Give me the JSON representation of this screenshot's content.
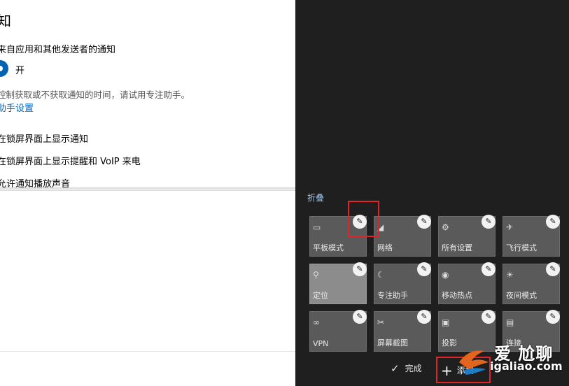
{
  "settings": {
    "heading": "知",
    "notify_from_apps": "来自应用和其他发送者的通知",
    "toggle_state": "开",
    "focus_hint": "控制获取或不获取通知的时间，请试用专注助手。",
    "focus_link": "助手设置",
    "lock_screen_notify": "在锁屏界面上显示通知",
    "lock_screen_voip": "在锁屏界面上显示提醒和 VoIP 来电",
    "allow_sound": "允许通知播放声音"
  },
  "action_center": {
    "collapse_label": "折叠",
    "tiles": [
      {
        "label": "平板模式",
        "icon": "tablet-mode-icon"
      },
      {
        "label": "网络",
        "icon": "network-icon"
      },
      {
        "label": "所有设置",
        "icon": "gear-icon"
      },
      {
        "label": "飞行模式",
        "icon": "airplane-icon"
      },
      {
        "label": "定位",
        "icon": "location-icon"
      },
      {
        "label": "专注助手",
        "icon": "moon-icon"
      },
      {
        "label": "移动热点",
        "icon": "hotspot-icon"
      },
      {
        "label": "夜间模式",
        "icon": "brightness-icon"
      },
      {
        "label": "VPN",
        "icon": "vpn-icon"
      },
      {
        "label": "屏幕截图",
        "icon": "screen-snip-icon"
      },
      {
        "label": "投影",
        "icon": "project-icon"
      },
      {
        "label": "连接",
        "icon": "connect-icon"
      }
    ],
    "done_label": "完成",
    "add_label": "添加"
  },
  "watermark": {
    "brand": "爱 尬聊",
    "url": "igaliao.com"
  },
  "colors": {
    "accent": "#0063b1",
    "link": "#0067c0",
    "panel_bg": "#1f1f1f",
    "tile_bg": "#5a5a5a",
    "highlight": "#e0242a"
  }
}
